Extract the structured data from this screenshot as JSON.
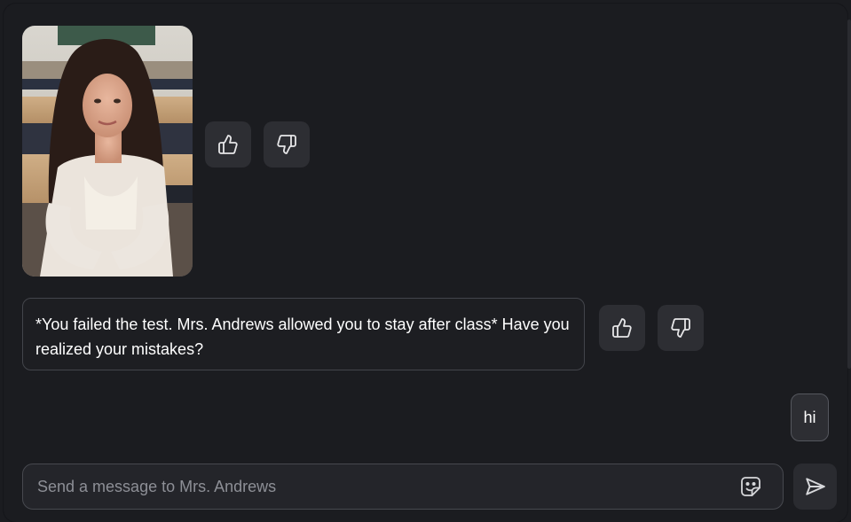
{
  "chat": {
    "messages": [
      {
        "type": "image",
        "sender": "bot",
        "image_icon": "photo-of-woman-in-classroom"
      },
      {
        "type": "text",
        "sender": "bot",
        "text": "*You failed the test. Mrs. Andrews allowed you to stay after class* Have you realized your mistakes?"
      },
      {
        "type": "text",
        "sender": "user",
        "text": "hi"
      }
    ],
    "reactions": {
      "like_icon": "thumbs-up-icon",
      "dislike_icon": "thumbs-down-icon"
    }
  },
  "composer": {
    "placeholder": "Send a message to Mrs. Andrews",
    "value": "",
    "sticker_icon": "sticker-icon",
    "send_icon": "send-icon"
  },
  "colors": {
    "background": "#1b1c20",
    "button": "#2d2e33",
    "border": "#43454b",
    "text": "#ffffff",
    "placeholder": "#8d8f96"
  }
}
